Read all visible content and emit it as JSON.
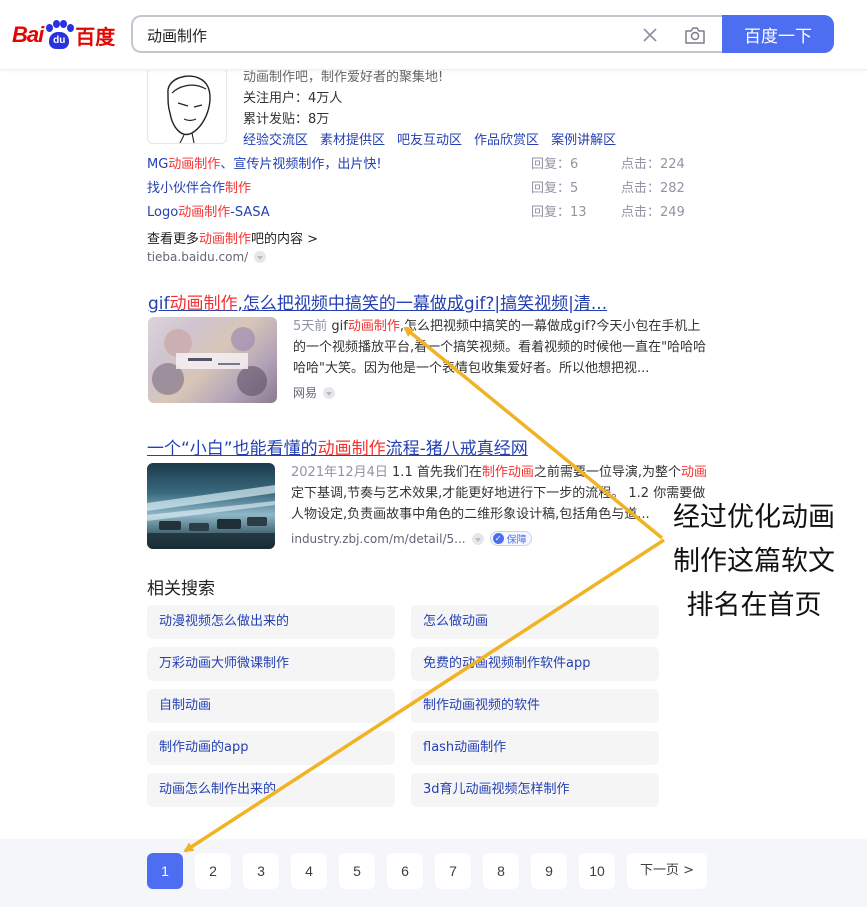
{
  "header": {
    "logo_text_left": "Bai",
    "logo_paw_text": "du",
    "logo_text_right": "百度",
    "search_value": "动画制作",
    "search_button_label": "百度一下"
  },
  "tieba": {
    "desc": "动画制作吧，制作爱好者的聚集地!",
    "followers": "关注用户：4万人",
    "posts": "累计发贴：8万",
    "tags": [
      "经验交流区",
      "素材提供区",
      "吧友互动区",
      "作品欣赏区",
      "案例讲解区"
    ],
    "threads": [
      {
        "pre": "MG",
        "em": "动画制作",
        "post": "、宣传片视频制作，出片快!",
        "reply": "回复：6",
        "clicks": "点击：224"
      },
      {
        "pre": "找小伙伴合作",
        "em": "制作",
        "post": "",
        "reply": "回复：5",
        "clicks": "点击：282"
      },
      {
        "pre": "Logo",
        "em": "动画制作",
        "post": "-SASA",
        "reply": "回复：13",
        "clicks": "点击：249"
      }
    ],
    "see_more_pre": "查看更多",
    "see_more_em": "动画制作",
    "see_more_post": "吧的内容 >",
    "source": "tieba.baidu.com/"
  },
  "result1": {
    "title_pre": "gif",
    "title_em": "动画制作",
    "title_post": ",怎么把视频中搞笑的一幕做成gif?|搞笑视频|清...",
    "date": "5天前",
    "snippet_pre": " gif",
    "snippet_em": "动画制作",
    "snippet_post": ",怎么把视频中搞笑的一幕做成gif?今天小包在手机上的一个视频播放平台,看一个搞笑视频。看着视频的时候他一直在\"哈哈哈哈哈\"大笑。因为他是一个表情包收集爱好者。所以他想把视...",
    "source": "网易"
  },
  "result2": {
    "title_pre": "一个“小白”也能看懂的",
    "title_em": "动画制作",
    "title_post": "流程-猪八戒真经网",
    "date": "2021年12月4日",
    "snippet_a": " 1.1 首先我们在",
    "snippet_em1": "制作动画",
    "snippet_b": "之前需要一位导演,为整个",
    "snippet_em2": "动画",
    "snippet_c": "定下基调,节奏与艺术效果,才能更好地进行下一步的流程。 1.2 你需要做人物设定,负责画故事中角色的二维形象设计稿,包括角色与道...",
    "source": "industry.zbj.com/m/detail/5...",
    "badge": "保障"
  },
  "related": {
    "title": "相关搜索",
    "items": [
      "动漫视频怎么做出来的",
      "怎么做动画",
      "万彩动画大师微课制作",
      "免费的动画视频制作软件app",
      "自制动画",
      "制作动画视频的软件",
      "制作动画的app",
      "flash动画制作",
      "动画怎么制作出来的",
      "3d育儿动画视频怎样制作"
    ]
  },
  "pagination": {
    "pages": [
      "1",
      "2",
      "3",
      "4",
      "5",
      "6",
      "7",
      "8",
      "9",
      "10"
    ],
    "current": "1",
    "next_label": "下一页 >"
  },
  "annotation": {
    "lines": [
      "经过优化动画",
      "制作这篇软文",
      "排名在首页"
    ],
    "arrow_color": "#f0b323"
  },
  "colors": {
    "brand_blue": "#4e6ef2",
    "link_blue": "#2440b3",
    "highlight_red": "#f73131",
    "logo_red": "#e10601"
  }
}
